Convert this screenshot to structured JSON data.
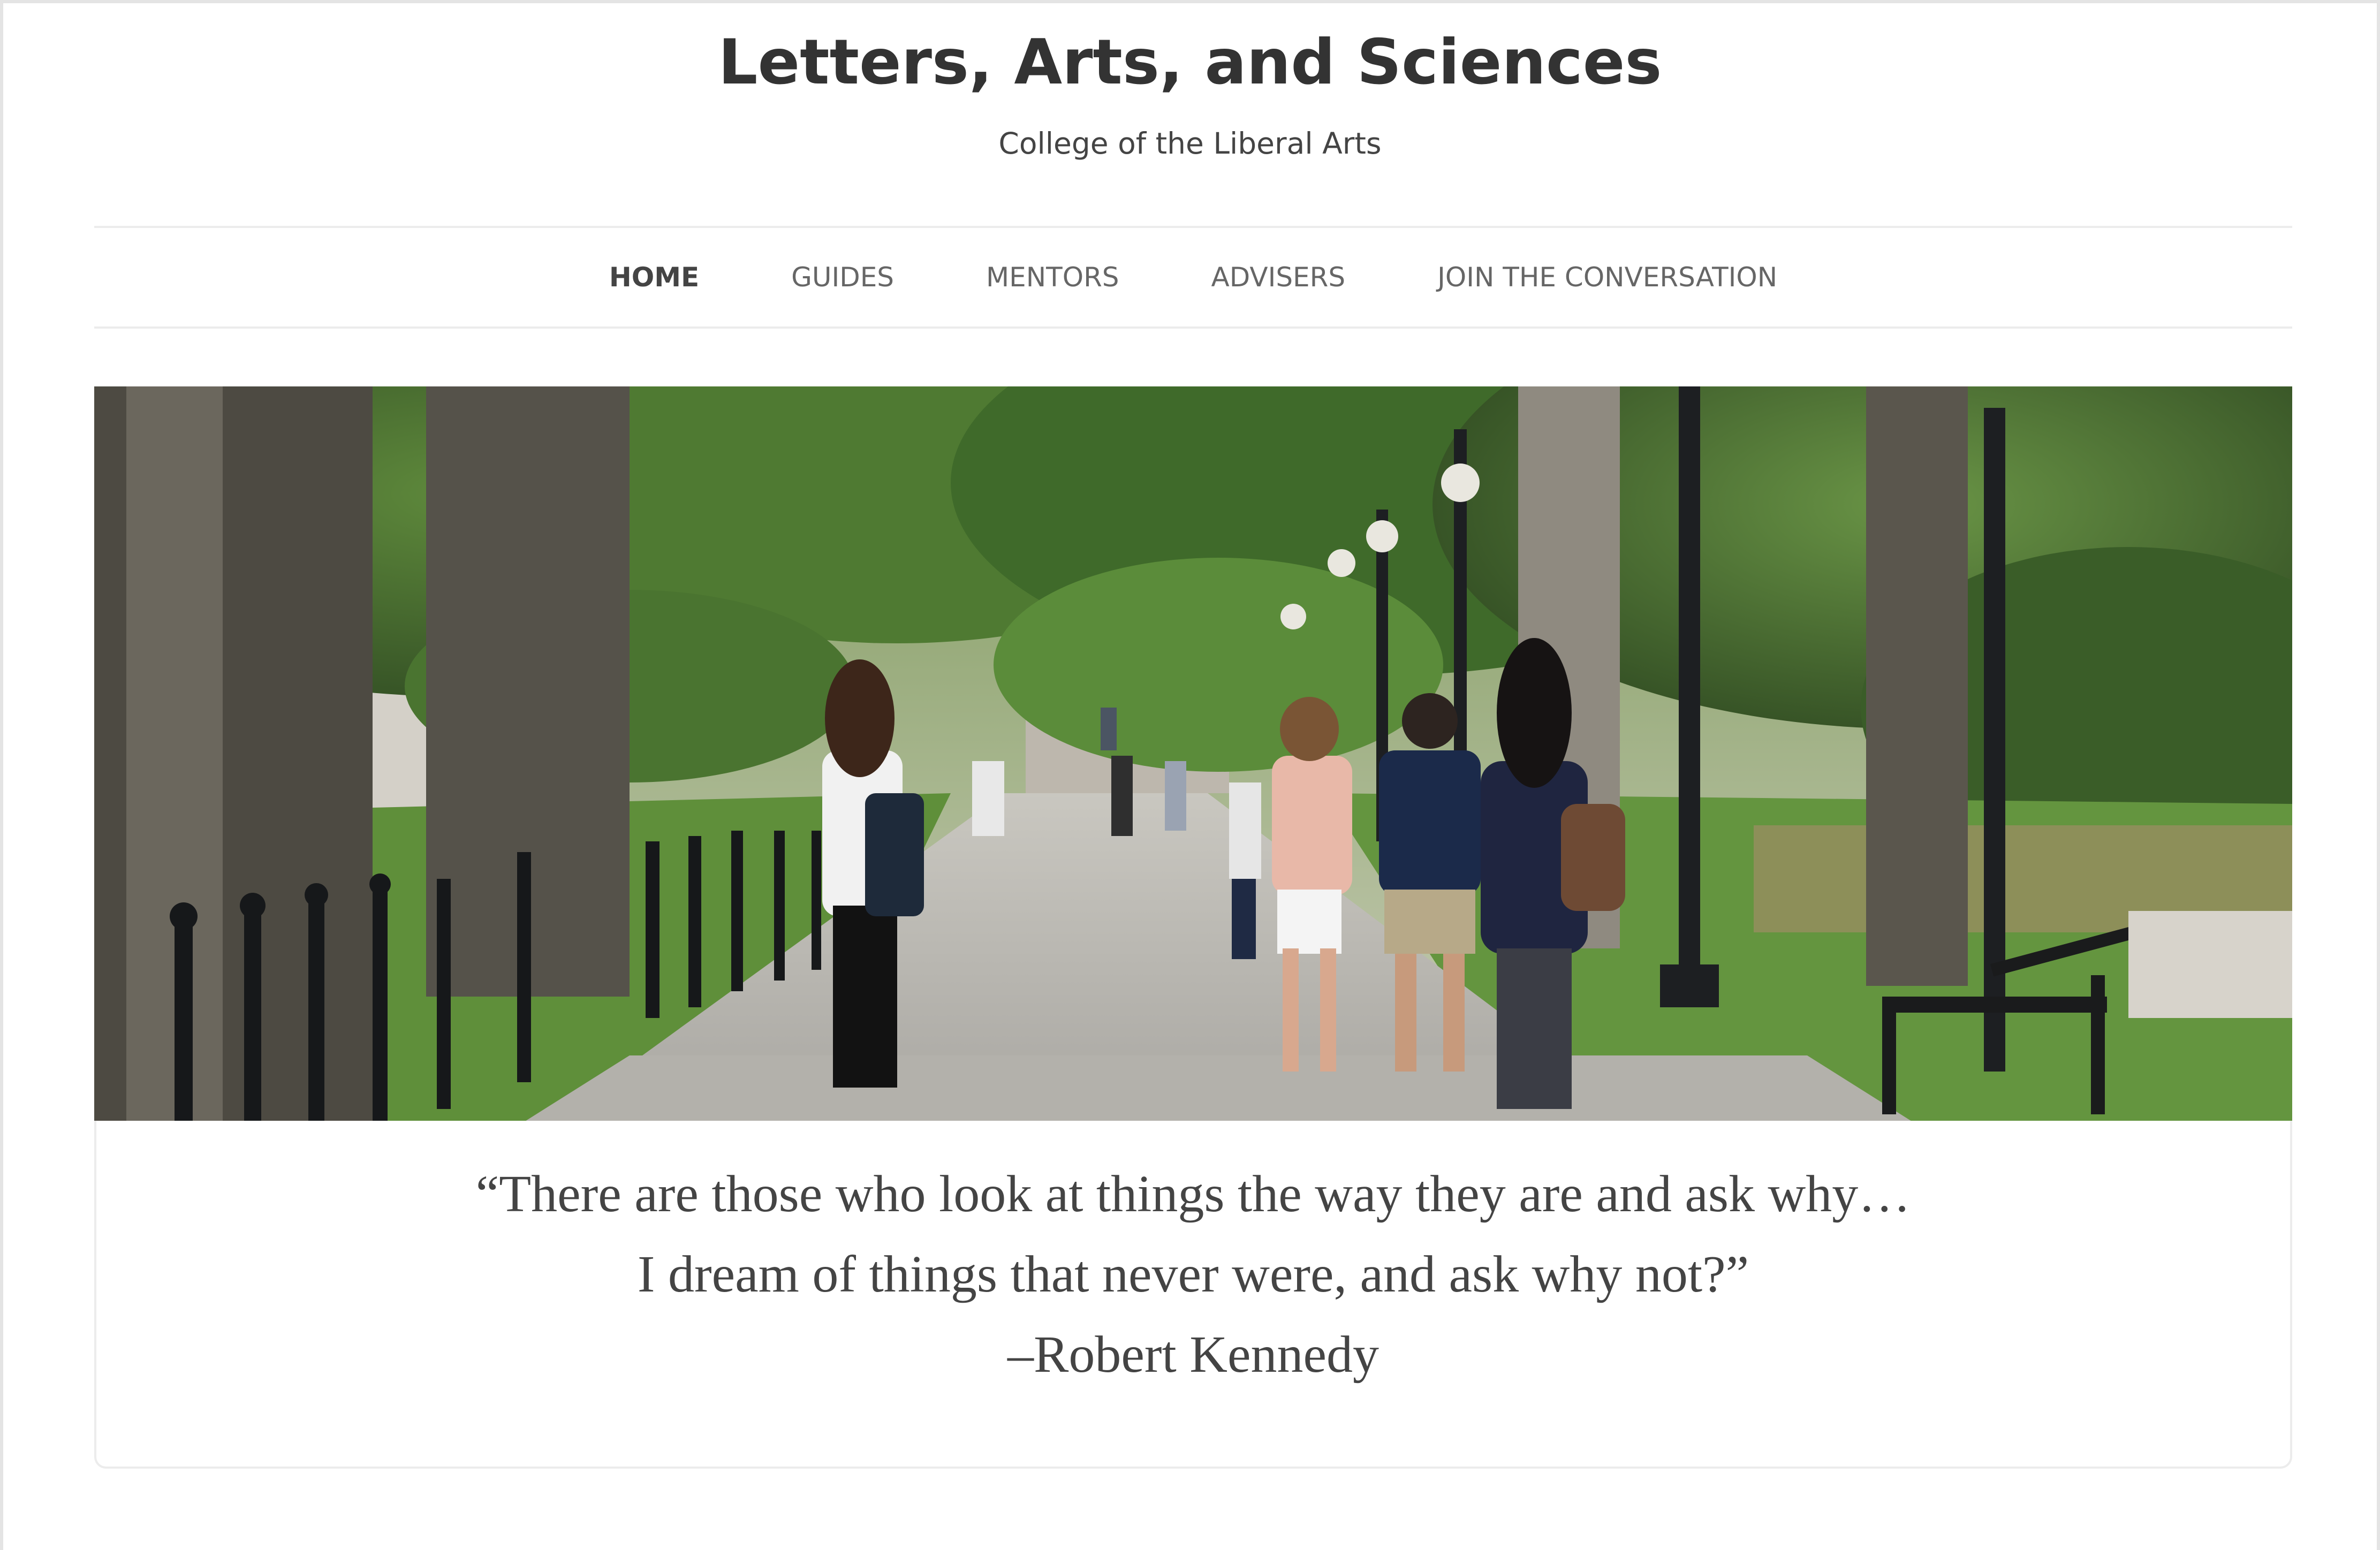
{
  "header": {
    "title": "Letters, Arts, and Sciences",
    "tagline": "College of the Liberal Arts"
  },
  "nav": {
    "items": [
      {
        "label": "HOME",
        "active": true
      },
      {
        "label": "GUIDES",
        "active": false
      },
      {
        "label": "MENTORS",
        "active": false
      },
      {
        "label": "ADVISERS",
        "active": false
      },
      {
        "label": "JOIN THE CONVERSATION",
        "active": false
      }
    ]
  },
  "hero": {
    "image": "campus-walkway-photo"
  },
  "quote": {
    "line1": "“There are those who look at things the way they are and ask why…",
    "line2": "I dream of things that never were, and ask why not?”",
    "attribution": "–Robert Kennedy"
  },
  "colors": {
    "title": "#333333",
    "nav_text": "#666666",
    "nav_active": "#444444",
    "divider": "#ececec",
    "quote_text": "#444444"
  }
}
